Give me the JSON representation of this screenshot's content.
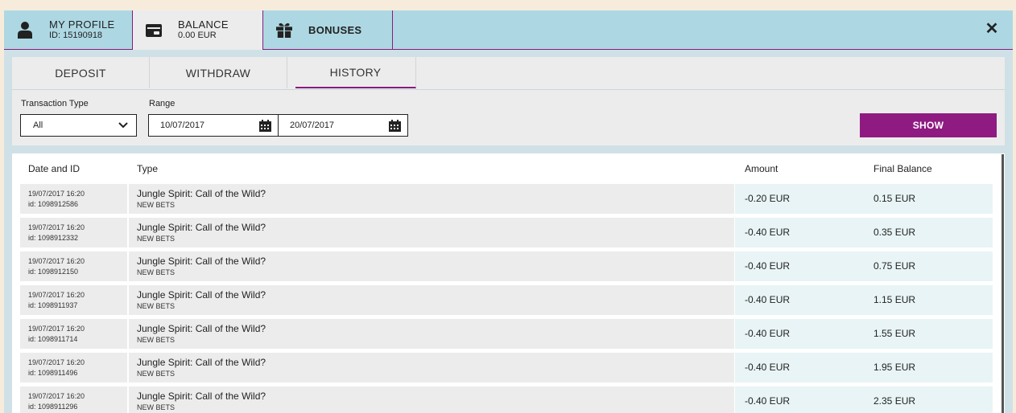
{
  "top_tabs": {
    "profile": {
      "title": "MY PROFILE",
      "sub": "ID: 15190918",
      "icon": "user-icon"
    },
    "balance": {
      "title": "BALANCE",
      "sub": "0.00 EUR",
      "icon": "wallet-icon"
    },
    "bonuses": {
      "title": "BONUSES",
      "icon": "gift-icon"
    },
    "close": "✕"
  },
  "sub_tabs": [
    "DEPOSIT",
    "WITHDRAW",
    "HISTORY"
  ],
  "filters": {
    "transaction_type_label": "Transaction Type",
    "transaction_type_value": "All",
    "range_label": "Range",
    "date_from": "10/07/2017",
    "date_to": "20/07/2017",
    "show_label": "SHOW"
  },
  "table": {
    "headers": [
      "Date and ID",
      "Type",
      "Amount",
      "Final Balance"
    ],
    "rows": [
      {
        "date": "19/07/2017 16:20",
        "id": "id: 1098912586",
        "title": "Jungle Spirit: Call of the Wild?",
        "sub": "NEW BETS",
        "amount": "-0.20 EUR",
        "balance": "0.15 EUR"
      },
      {
        "date": "19/07/2017 16:20",
        "id": "id: 1098912332",
        "title": "Jungle Spirit: Call of the Wild?",
        "sub": "NEW BETS",
        "amount": "-0.40 EUR",
        "balance": "0.35 EUR"
      },
      {
        "date": "19/07/2017 16:20",
        "id": "id: 1098912150",
        "title": "Jungle Spirit: Call of the Wild?",
        "sub": "NEW BETS",
        "amount": "-0.40 EUR",
        "balance": "0.75 EUR"
      },
      {
        "date": "19/07/2017 16:20",
        "id": "id: 1098911937",
        "title": "Jungle Spirit: Call of the Wild?",
        "sub": "NEW BETS",
        "amount": "-0.40 EUR",
        "balance": "1.15 EUR"
      },
      {
        "date": "19/07/2017 16:20",
        "id": "id: 1098911714",
        "title": "Jungle Spirit: Call of the Wild?",
        "sub": "NEW BETS",
        "amount": "-0.40 EUR",
        "balance": "1.55 EUR"
      },
      {
        "date": "19/07/2017 16:20",
        "id": "id: 1098911496",
        "title": "Jungle Spirit: Call of the Wild?",
        "sub": "NEW BETS",
        "amount": "-0.40 EUR",
        "balance": "1.95 EUR"
      },
      {
        "date": "19/07/2017 16:20",
        "id": "id: 1098911296",
        "title": "Jungle Spirit: Call of the Wild?",
        "sub": "NEW BETS",
        "amount": "-0.40 EUR",
        "balance": "2.35 EUR"
      }
    ]
  },
  "colors": {
    "accent": "#8f1b82",
    "topbar": "#add8e3",
    "background": "#f7ecdc"
  }
}
